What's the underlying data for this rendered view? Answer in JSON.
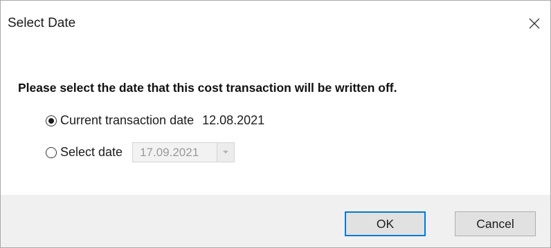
{
  "dialog": {
    "title": "Select Date",
    "close_icon": "close-icon"
  },
  "prompt": "Please select the date that this cost transaction will be written off.",
  "options": {
    "current": {
      "label": "Current transaction date",
      "value": "12.08.2021",
      "checked": true
    },
    "select": {
      "label": "Select date",
      "date_value": "17.09.2021",
      "checked": false,
      "enabled": false,
      "dropdown_icon": "chevron-down-icon"
    }
  },
  "buttons": {
    "ok_label": "OK",
    "cancel_label": "Cancel"
  },
  "colors": {
    "focus_border": "#0078d7",
    "footer_bg": "#f0f0f0",
    "button_bg": "#e1e1e1",
    "disabled_text": "#9a9a9a"
  }
}
